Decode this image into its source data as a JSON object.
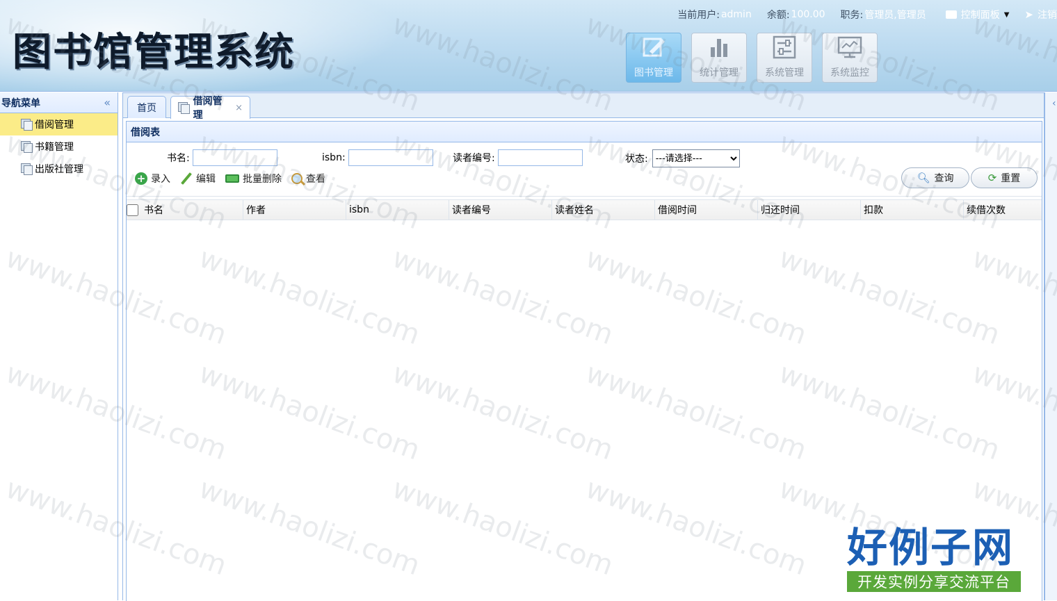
{
  "app": {
    "title": "图书馆管理系统"
  },
  "userbar": {
    "user_label": "当前用户:",
    "user_value": "admin",
    "balance_label": "余额:",
    "balance_value": "100.00",
    "role_label": "职务:",
    "role_value": "管理员,管理员",
    "control_panel": "控制面板",
    "logout": "注销"
  },
  "modules": [
    {
      "label": "图书管理",
      "icon": "edit-square-icon",
      "active": true
    },
    {
      "label": "统计管理",
      "icon": "bar-chart-icon",
      "active": false
    },
    {
      "label": "系统管理",
      "icon": "settings-sliders-icon",
      "active": false
    },
    {
      "label": "系统监控",
      "icon": "monitor-icon",
      "active": false
    }
  ],
  "nav": {
    "title": "导航菜单",
    "collapse_icon": "double-chevron-left-icon",
    "items": [
      {
        "label": "借阅管理",
        "active": true
      },
      {
        "label": "书籍管理",
        "active": false
      },
      {
        "label": "出版社管理",
        "active": false
      }
    ]
  },
  "tabs": {
    "home": "首页",
    "active": "借阅管理",
    "close": "×"
  },
  "panel": {
    "title": "借阅表",
    "search": {
      "book_name_label": "书名:",
      "book_name_value": "",
      "isbn_label": "isbn:",
      "isbn_value": "",
      "reader_no_label": "读者编号:",
      "reader_no_value": "",
      "status_label": "状态:",
      "status_selected": "---请选择---"
    },
    "toolbar": {
      "add": "录入",
      "edit": "编辑",
      "batch_delete": "批量删除",
      "view": "查看"
    },
    "buttons": {
      "query": "查询",
      "reset": "重置"
    },
    "columns": [
      "书名",
      "作者",
      "isbn",
      "读者编号",
      "读者姓名",
      "借阅时间",
      "归还时间",
      "扣款",
      "续借次数"
    ],
    "rows": []
  },
  "watermark": "www.haolizi.com",
  "brand": {
    "main": "好例子网",
    "sub": "开发实例分享交流平台",
    "main_color": "#1c5fb4",
    "sub_bg": "#5aa83a"
  }
}
